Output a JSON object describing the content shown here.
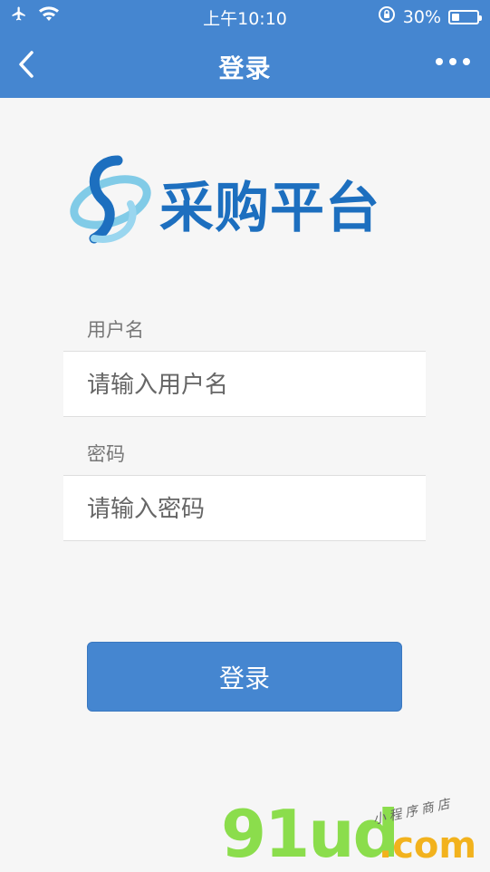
{
  "status_bar": {
    "time": "上午10:10",
    "battery_percent": "30%",
    "battery_level": 0.3
  },
  "nav": {
    "title": "登录"
  },
  "logo": {
    "text": "采购平台",
    "colors": {
      "primary": "#1d6fbf",
      "secondary": "#6cc3e4"
    }
  },
  "form": {
    "username": {
      "label": "用户名",
      "placeholder": "请输入用户名",
      "value": ""
    },
    "password": {
      "label": "密码",
      "placeholder": "请输入密码",
      "value": ""
    },
    "submit_label": "登录"
  },
  "watermark": {
    "main": "91ud",
    "tld": ".com",
    "sub": "小程序商店"
  },
  "colors": {
    "accent": "#4586d0",
    "background": "#f6f6f6"
  }
}
